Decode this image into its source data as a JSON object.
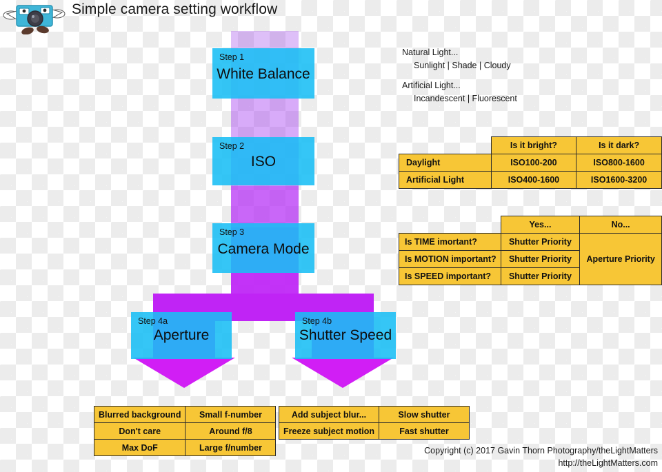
{
  "header": {
    "title": "Simple camera setting workflow",
    "mascot_icon": "camera-mascot-icon"
  },
  "steps": [
    {
      "num": "Step 1",
      "title": "White Balance"
    },
    {
      "num": "Step 2",
      "title": "ISO"
    },
    {
      "num": "Step 3",
      "title": "Camera Mode"
    },
    {
      "num": "Step 4a",
      "title": "Aperture"
    },
    {
      "num": "Step 4b",
      "title": "Shutter Speed"
    }
  ],
  "light_note": {
    "natural_label": "Natural Light...",
    "natural_values": "Sunlight | Shade | Cloudy",
    "artificial_label": "Artificial Light...",
    "artificial_values": "Incandescent | Fluorescent"
  },
  "iso_table": {
    "headers": [
      "",
      "Is it bright?",
      "Is it dark?"
    ],
    "rows": [
      [
        "Daylight",
        "ISO100-200",
        "ISO800-1600"
      ],
      [
        "Artificial Light",
        "ISO400-1600",
        "ISO1600-3200"
      ]
    ]
  },
  "mode_table": {
    "headers": [
      "",
      "Yes...",
      "No..."
    ],
    "rows": [
      [
        "Is TIME imortant?",
        "Shutter Priority"
      ],
      [
        "Is MOTION important?",
        "Shutter Priority"
      ],
      [
        "Is SPEED important?",
        "Shutter Priority"
      ]
    ],
    "merged_no_cell": "Aperture Priority"
  },
  "aperture_table": {
    "rows": [
      [
        "Blurred background",
        "Small f-number"
      ],
      [
        "Don't care",
        "Around f/8"
      ],
      [
        "Max DoF",
        "Large f/number"
      ]
    ]
  },
  "shutter_table": {
    "rows": [
      [
        "Add subject blur...",
        "Slow shutter"
      ],
      [
        "Freeze subject motion",
        "Fast shutter"
      ]
    ]
  },
  "footer": {
    "line1": "Copyright (c) 2017 Gavin Thorn Photography/theLightMatters",
    "line2": "http://theLightMatters.com"
  },
  "colors": {
    "cyan_box": "#19bef5",
    "magenta_arrow": "#c024f5",
    "gold_table": "#f7c636",
    "border": "#2b2b2b",
    "text": "#111111"
  }
}
